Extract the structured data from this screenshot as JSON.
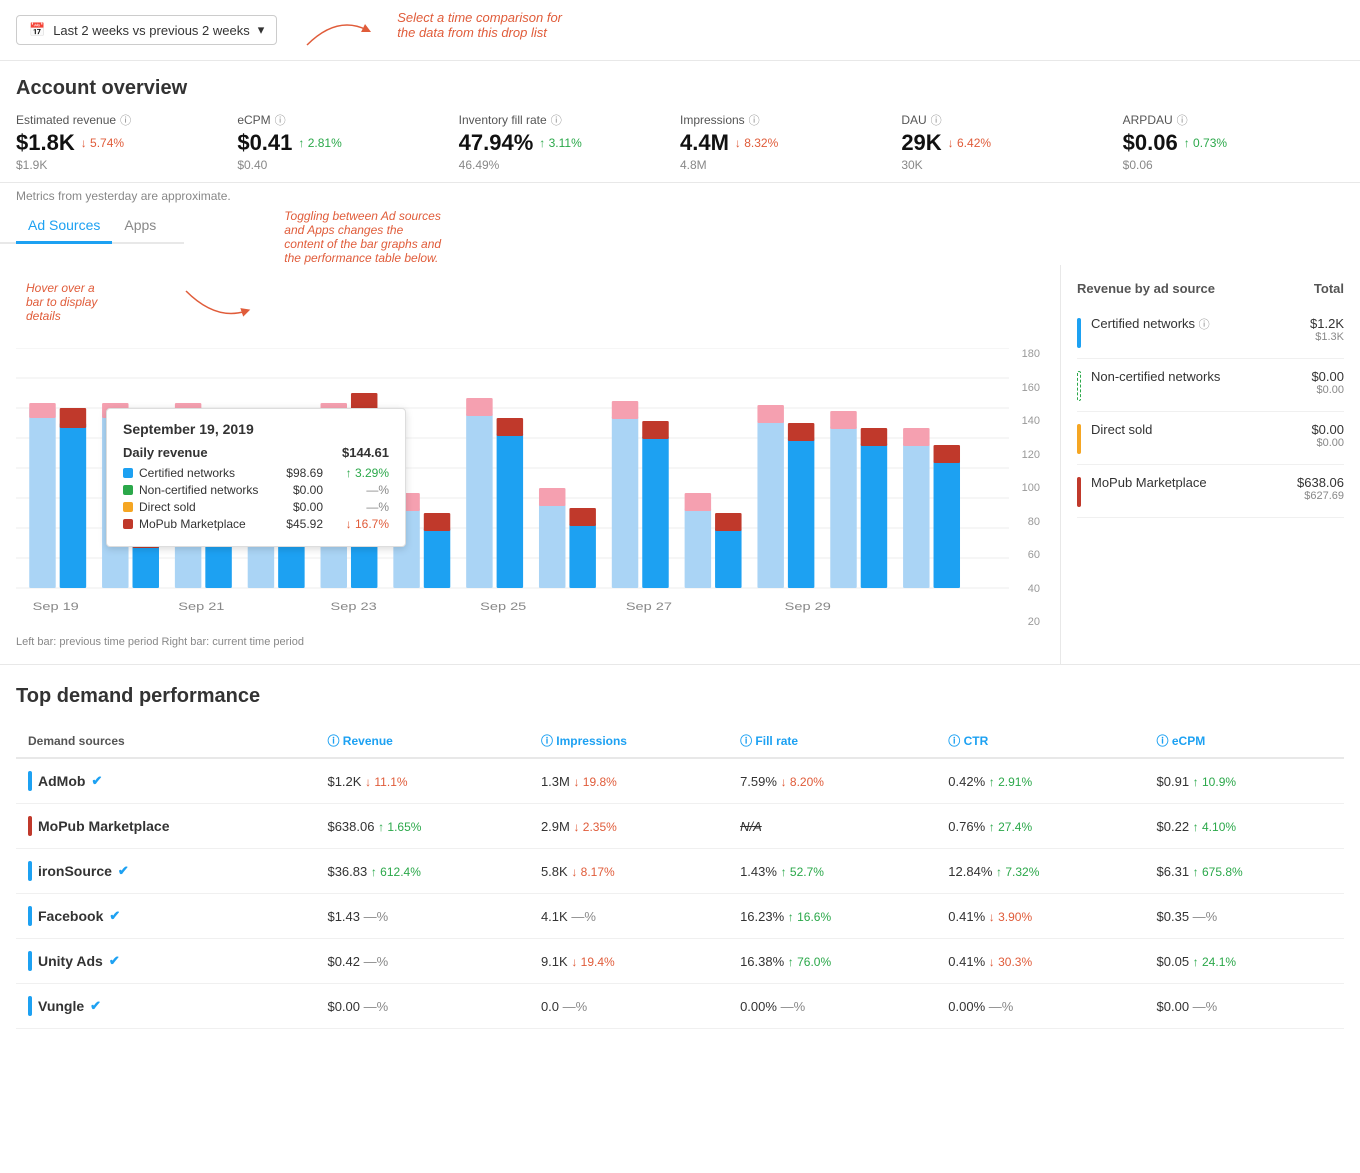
{
  "topBar": {
    "datePicker": "Last 2 weeks vs previous 2 weeks",
    "annotation": "Select a time comparison for\nthe data from this drop list"
  },
  "accountOverview": {
    "title": "Account overview",
    "metrics": [
      {
        "label": "Estimated revenue",
        "value": "$1.8K",
        "change": "5.74%",
        "direction": "down",
        "prev": "$1.9K"
      },
      {
        "label": "eCPM",
        "value": "$0.41",
        "change": "2.81%",
        "direction": "up",
        "prev": "$0.40"
      },
      {
        "label": "Inventory fill rate",
        "value": "47.94%",
        "change": "3.11%",
        "direction": "up",
        "prev": "46.49%"
      },
      {
        "label": "Impressions",
        "value": "4.4M",
        "change": "8.32%",
        "direction": "down",
        "prev": "4.8M"
      },
      {
        "label": "DAU",
        "value": "29K",
        "change": "6.42%",
        "direction": "down",
        "prev": "30K"
      },
      {
        "label": "ARPDAU",
        "value": "$0.06",
        "change": "0.73%",
        "direction": "up",
        "prev": "$0.06"
      }
    ]
  },
  "approxNote": "Metrics from yesterday are approximate.",
  "tabAnnotation": "Toggling between Ad sources\nand Apps changes the\ncontent of the bar graphs and\nthe performance table below.",
  "tabs": [
    {
      "label": "Ad Sources",
      "active": true
    },
    {
      "label": "Apps",
      "active": false
    }
  ],
  "chartAnnotation": "Hover over a\nbar to display\ndetails",
  "chartLegendNote": "Left bar: previous time period    Right bar: current time period",
  "yAxisLabels": [
    "180",
    "160",
    "140",
    "120",
    "100",
    "80",
    "60",
    "40",
    "20"
  ],
  "xAxisLabels": [
    "Sep 19",
    "Sep 21",
    "Sep 23",
    "Sep 25",
    "Sep 27",
    "Sep 29"
  ],
  "tooltip": {
    "date": "September 19, 2019",
    "dailyLabel": "Daily revenue",
    "dailyValue": "$144.61",
    "rows": [
      {
        "label": "Certified networks",
        "amount": "$98.69",
        "change": "3.29%",
        "direction": "up",
        "color": "#1da1f2"
      },
      {
        "label": "Non-certified networks",
        "amount": "$0.00",
        "change": "—%",
        "direction": "none",
        "color": "#2ba84a"
      },
      {
        "label": "Direct sold",
        "amount": "$0.00",
        "change": "—%",
        "direction": "none",
        "color": "#f5a623"
      },
      {
        "label": "MoPub Marketplace",
        "amount": "$45.92",
        "change": "16.7%",
        "direction": "down",
        "color": "#c0392b"
      }
    ]
  },
  "revenueSidebar": {
    "title": "Revenue by ad source",
    "totalLabel": "Total",
    "rows": [
      {
        "label": "Certified networks",
        "info": true,
        "total": "$1.2K",
        "prev": "$1.3K",
        "color": "#1da1f2"
      },
      {
        "label": "Non-certified networks",
        "info": false,
        "total": "$0.00",
        "prev": "$0.00",
        "color": "#2ba84a",
        "dashed": true
      },
      {
        "label": "Direct sold",
        "info": false,
        "total": "$0.00",
        "prev": "$0.00",
        "color": "#f5a623"
      },
      {
        "label": "MoPub Marketplace",
        "info": false,
        "total": "$638.06",
        "prev": "$627.69",
        "color": "#c0392b"
      }
    ]
  },
  "performance": {
    "title": "Top demand performance",
    "columns": [
      "Demand sources",
      "Revenue",
      "Impressions",
      "Fill rate",
      "CTR",
      "eCPM"
    ],
    "rows": [
      {
        "name": "AdMob",
        "verified": true,
        "color": "#1da1f2",
        "revenue": "$1.2K",
        "revChange": "11.1%",
        "revDir": "down",
        "impressions": "1.3M",
        "impChange": "19.8%",
        "impDir": "down",
        "fillRate": "7.59%",
        "fillChange": "8.20%",
        "fillDir": "down",
        "ctr": "0.42%",
        "ctrChange": "2.91%",
        "ctrDir": "up",
        "ecpm": "$0.91",
        "ecpmChange": "10.9%",
        "ecpmDir": "up"
      },
      {
        "name": "MoPub Marketplace",
        "verified": false,
        "color": "#c0392b",
        "revenue": "$638.06",
        "revChange": "1.65%",
        "revDir": "up",
        "impressions": "2.9M",
        "impChange": "2.35%",
        "impDir": "down",
        "fillRate": "N/A",
        "fillChange": "",
        "fillDir": "none",
        "ctr": "0.76%",
        "ctrChange": "27.4%",
        "ctrDir": "up",
        "ecpm": "$0.22",
        "ecpmChange": "4.10%",
        "ecpmDir": "up"
      },
      {
        "name": "ironSource",
        "verified": true,
        "color": "#1da1f2",
        "revenue": "$36.83",
        "revChange": "612.4%",
        "revDir": "up",
        "impressions": "5.8K",
        "impChange": "8.17%",
        "impDir": "down",
        "fillRate": "1.43%",
        "fillChange": "52.7%",
        "fillDir": "up",
        "ctr": "12.84%",
        "ctrChange": "7.32%",
        "ctrDir": "up",
        "ecpm": "$6.31",
        "ecpmChange": "675.8%",
        "ecpmDir": "up"
      },
      {
        "name": "Facebook",
        "verified": true,
        "color": "#1da1f2",
        "revenue": "$1.43",
        "revChange": "—%",
        "revDir": "none",
        "impressions": "4.1K",
        "impChange": "—%",
        "impDir": "none",
        "fillRate": "16.23%",
        "fillChange": "16.6%",
        "fillDir": "up",
        "ctr": "0.41%",
        "ctrChange": "3.90%",
        "ctrDir": "down",
        "ecpm": "$0.35",
        "ecpmChange": "—%",
        "ecpmDir": "none"
      },
      {
        "name": "Unity Ads",
        "verified": true,
        "color": "#1da1f2",
        "revenue": "$0.42",
        "revChange": "—%",
        "revDir": "none",
        "impressions": "9.1K",
        "impChange": "19.4%",
        "impDir": "down",
        "fillRate": "16.38%",
        "fillChange": "76.0%",
        "fillDir": "up",
        "ctr": "0.41%",
        "ctrChange": "30.3%",
        "ctrDir": "down",
        "ecpm": "$0.05",
        "ecpmChange": "24.1%",
        "ecpmDir": "up"
      },
      {
        "name": "Vungle",
        "verified": true,
        "color": "#1da1f2",
        "revenue": "$0.00",
        "revChange": "—%",
        "revDir": "none",
        "impressions": "0.0",
        "impChange": "—%",
        "impDir": "none",
        "fillRate": "0.00%",
        "fillChange": "—%",
        "fillDir": "none",
        "ctr": "0.00%",
        "ctrChange": "—%",
        "ctrDir": "none",
        "ecpm": "$0.00",
        "ecpmChange": "—%",
        "ecpmDir": "none"
      }
    ]
  }
}
